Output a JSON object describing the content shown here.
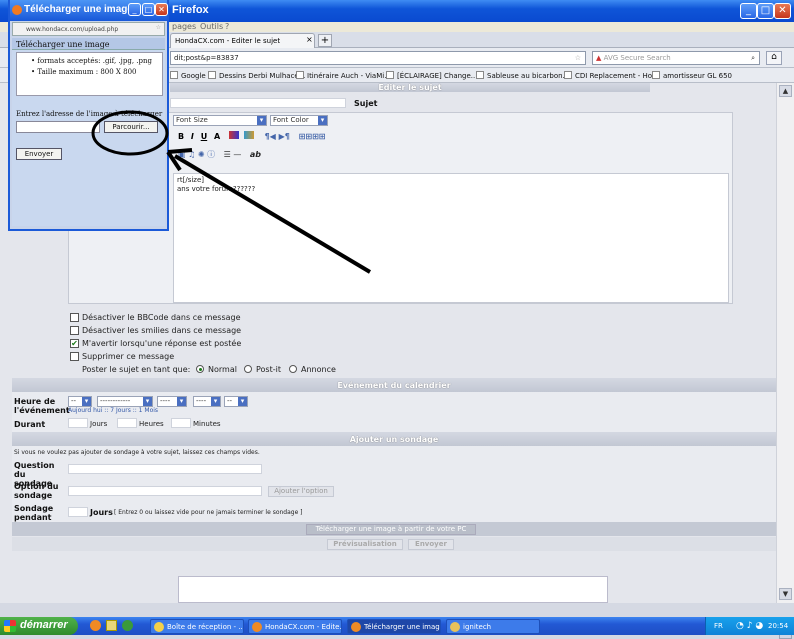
{
  "browser": {
    "title": "Firefox",
    "menu": [
      "pages",
      "Outils",
      "?"
    ],
    "tab_active": "HondaCX.com - Editer le sujet",
    "url_fragment": "dit;post&p=83837",
    "search_placeholder": "AVG Secure Search",
    "bookmarks": [
      "Google",
      "Dessins Derbi Mulhacé...",
      "Itinéraire Auch - ViaMi...",
      "[ÉCLAIRAGE] Change...",
      "Sableuse au bicarbon...",
      "CDI Replacement - Ho...",
      "amortisseur GL 650"
    ]
  },
  "popup": {
    "title": "Télécharger une image...",
    "url": "www.hondacx.com/upload.php",
    "heading": "Télécharger une image",
    "bullets": [
      "formats acceptés: .gif, .jpg, .png",
      "Taille maximum : 800 X 800"
    ],
    "prompt": "Entrez l'adresse de l'image à télécharger",
    "browse_label": "Parcourir...",
    "send_label": "Envoyer"
  },
  "editor": {
    "top_header": "Editer le sujet",
    "subject_label": "Sujet",
    "font_size_label": "Font Size",
    "font_color_label": "Font Color",
    "text_line1": "rt[/size]",
    "text_line2": "ans votre forum??????"
  },
  "options": {
    "items": [
      {
        "label": "Désactiver le BBCode dans ce message",
        "checked": false
      },
      {
        "label": "Désactiver les smilies dans ce message",
        "checked": false
      },
      {
        "label": "M'avertir lorsqu'une réponse est postée",
        "checked": true
      },
      {
        "label": "Supprimer ce message",
        "checked": false
      }
    ],
    "post_as_label": "Poster le sujet en tant que:",
    "radio": [
      "Normal",
      "Post-it",
      "Annonce"
    ]
  },
  "calendar": {
    "header": "Evénement du calendrier",
    "time_label": "Heure de l'événement",
    "sel_day": "--",
    "sel_month": "------------",
    "sel_year": "----",
    "sel_hour": "----",
    "sel_min": "--",
    "links": "Aujourd hui :: 7 Jours :: 1 Mois",
    "duration_label": "Durant",
    "days": "Jours",
    "hours": "Heures",
    "minutes": "Minutes"
  },
  "poll": {
    "header": "Ajouter un sondage",
    "hint": "Si vous ne voulez pas ajouter de sondage à votre sujet, laissez ces champs vides.",
    "question_label": "Question du sondage",
    "option_label": "Option du sondage",
    "add_option": "Ajouter l'option",
    "duration_label": "Sondage pendant",
    "days": "Jours",
    "duration_hint": "[ Entrez 0 ou laissez vide pour ne jamais terminer le sondage ]"
  },
  "upload_bar": "Télécharger une image à partir de votre PC",
  "buttons": {
    "preview": "Prévisualisation",
    "send": "Envoyer"
  },
  "taskbar": {
    "start": "démarrer",
    "tasks": [
      "Boîte de réception - ...",
      "HondaCX.com - Edite...",
      "Télécharger une imag...",
      "ignitech"
    ],
    "lang": "FR",
    "clock": "20:54"
  }
}
